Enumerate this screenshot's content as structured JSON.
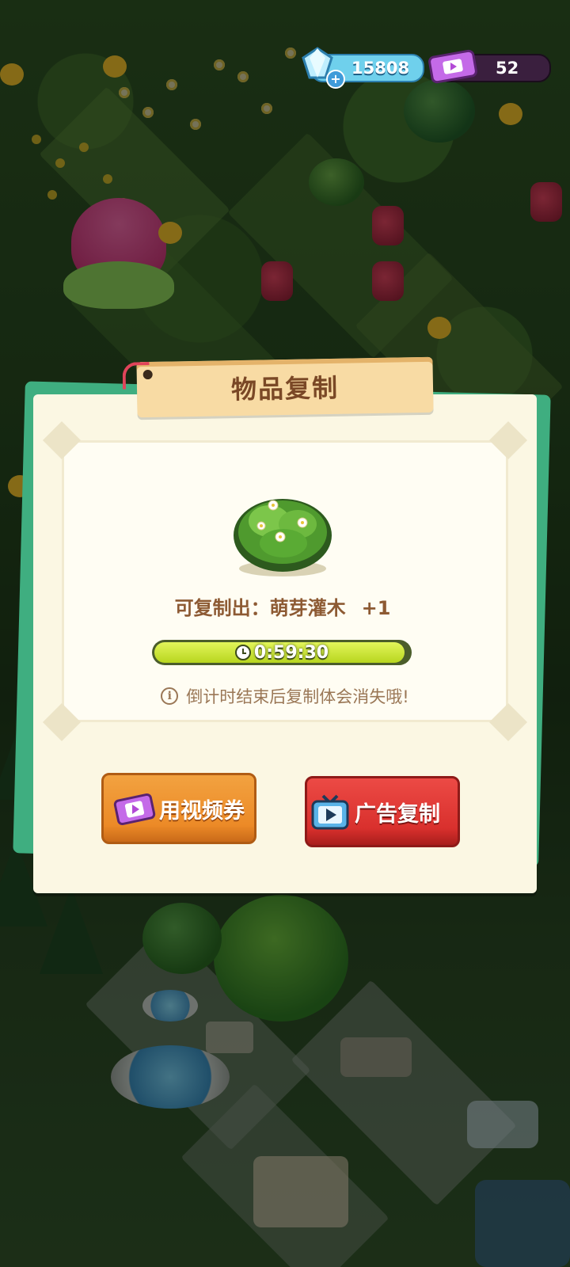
{
  "hud": {
    "gems": {
      "amount": "15808",
      "icon": "diamond-icon",
      "add_icon": "plus-icon"
    },
    "tickets": {
      "amount": "52",
      "icon": "video-ticket-icon"
    }
  },
  "dialog": {
    "title": "物品复制",
    "item": {
      "name": "萌芽灌木",
      "icon": "sprout-bush-icon"
    },
    "yield_prefix": "可复制出：",
    "yield_amount": "+1",
    "timer": {
      "label": "0:59:30",
      "progress": 0.98
    },
    "notice": "倒计时结束后复制体会消失哦!",
    "buttons": {
      "voucher": "用视频券",
      "ad": "广告复制"
    }
  },
  "colors": {
    "dialog_bg": "#fbf7e3",
    "title_banner": "#f8dba4",
    "voucher_button": "#ec8a27",
    "ad_button": "#d9302d",
    "timer_fill": "#c7e231",
    "text_brown": "#8d5a33"
  }
}
